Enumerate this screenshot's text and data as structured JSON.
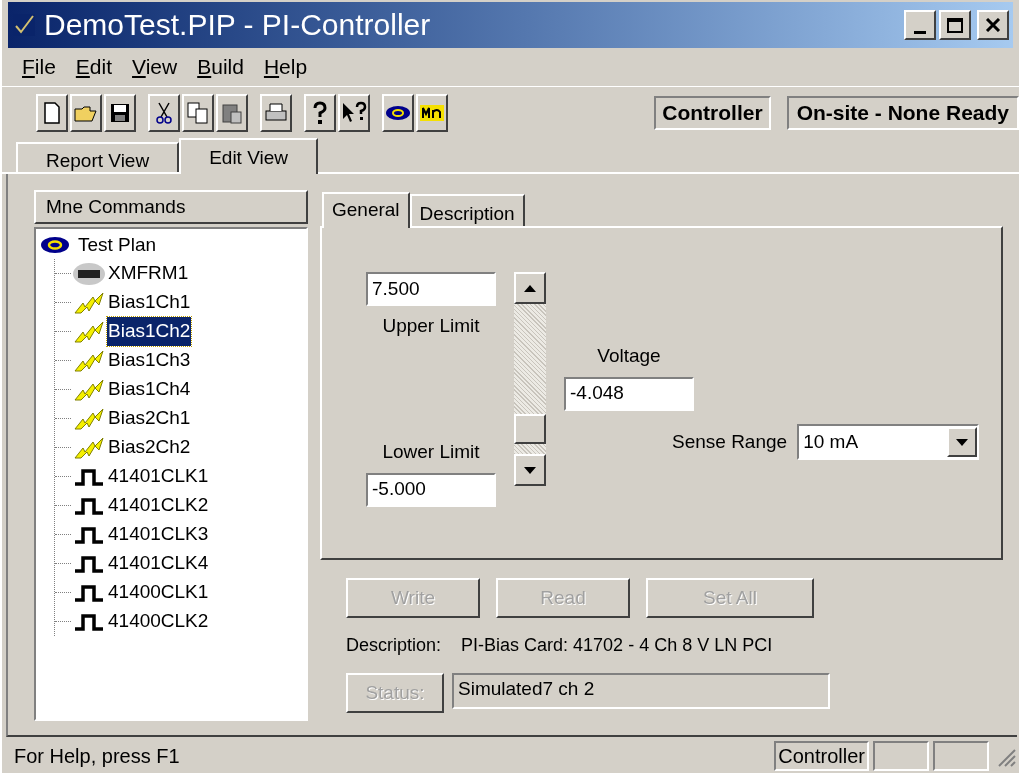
{
  "window": {
    "title": "DemoTest.PIP - PI-Controller"
  },
  "menu": [
    "File",
    "Edit",
    "View",
    "Build",
    "Help"
  ],
  "toolbar": {
    "mode": "Controller",
    "status": "On-site - None Ready"
  },
  "view_tabs": [
    {
      "label": "Report View",
      "selected": false
    },
    {
      "label": "Edit View",
      "selected": true
    }
  ],
  "tree": {
    "header": "Mne Commands",
    "root": "Test Plan",
    "children": [
      {
        "label": "XMFRM1",
        "kind": "card",
        "selected": false
      },
      {
        "label": "Bias1Ch1",
        "kind": "bias",
        "selected": false
      },
      {
        "label": "Bias1Ch2",
        "kind": "bias",
        "selected": true
      },
      {
        "label": "Bias1Ch3",
        "kind": "bias",
        "selected": false
      },
      {
        "label": "Bias1Ch4",
        "kind": "bias",
        "selected": false
      },
      {
        "label": "Bias2Ch1",
        "kind": "bias",
        "selected": false
      },
      {
        "label": "Bias2Ch2",
        "kind": "bias",
        "selected": false
      },
      {
        "label": "41401CLK1",
        "kind": "clock",
        "selected": false
      },
      {
        "label": "41401CLK2",
        "kind": "clock",
        "selected": false
      },
      {
        "label": "41401CLK3",
        "kind": "clock",
        "selected": false
      },
      {
        "label": "41401CLK4",
        "kind": "clock",
        "selected": false
      },
      {
        "label": "41400CLK1",
        "kind": "clock",
        "selected": false
      },
      {
        "label": "41400CLK2",
        "kind": "clock",
        "selected": false
      }
    ]
  },
  "detail_tabs": [
    {
      "label": "General",
      "selected": true
    },
    {
      "label": "Description",
      "selected": false
    }
  ],
  "general": {
    "upper_limit": {
      "label": "Upper Limit",
      "value": "7.500"
    },
    "lower_limit": {
      "label": "Lower Limit",
      "value": "-5.000"
    },
    "slider": {
      "level": 0.08
    },
    "voltage": {
      "label": "Voltage",
      "value": "-4.048"
    },
    "sense_range": {
      "label": "Sense Range",
      "value": "10 mA"
    }
  },
  "buttons": [
    {
      "label": "Write",
      "disabled": true
    },
    {
      "label": "Read",
      "disabled": true
    },
    {
      "label": "Set All",
      "disabled": true
    }
  ],
  "description": {
    "label": "Description:",
    "value": "PI-Bias Card: 41702 - 4 Ch 8 V LN PCI"
  },
  "status": {
    "button": "Status:",
    "disabled": true,
    "value": "Simulated7 ch 2"
  },
  "status_bar": {
    "message": "For Help, press F1",
    "panes": [
      "Controller"
    ]
  }
}
